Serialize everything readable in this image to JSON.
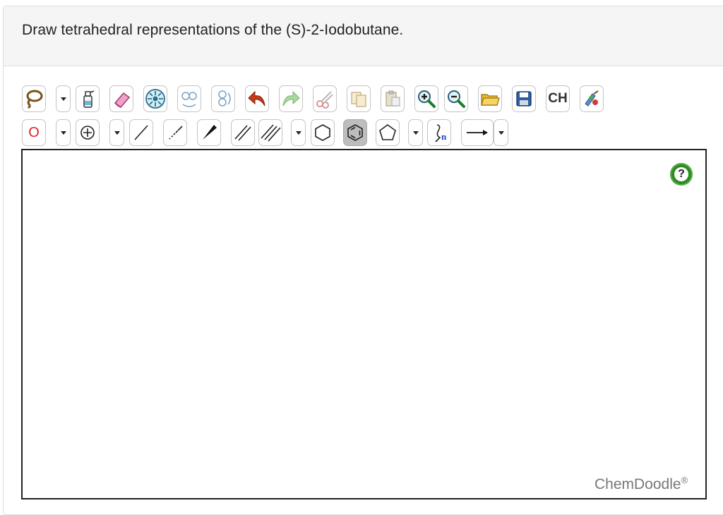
{
  "question": "Draw tetrahedral representations of the (S)-2-Iodobutane.",
  "toolbar_row1": [
    {
      "name": "lasso-tool-button",
      "icon": "lasso-icon"
    },
    {
      "name": "lasso-dropdown-button",
      "icon": "chevron-down-icon"
    },
    {
      "name": "clear-canvas-button",
      "icon": "spray-bottle-icon"
    },
    {
      "name": "eraser-button",
      "icon": "eraser-icon"
    },
    {
      "name": "center-molecule-button",
      "icon": "center-arrows-icon"
    },
    {
      "name": "flip-horizontal-button",
      "icon": "flip-horizontal-icon"
    },
    {
      "name": "flip-vertical-button",
      "icon": "flip-vertical-icon"
    },
    {
      "name": "undo-button",
      "icon": "undo-arrow-icon"
    },
    {
      "name": "redo-button",
      "icon": "redo-arrow-icon"
    },
    {
      "name": "cut-button",
      "icon": "scissors-icon"
    },
    {
      "name": "copy-button",
      "icon": "copy-icon"
    },
    {
      "name": "paste-button",
      "icon": "paste-icon"
    },
    {
      "name": "zoom-in-button",
      "icon": "zoom-in-icon"
    },
    {
      "name": "zoom-out-button",
      "icon": "zoom-out-icon"
    },
    {
      "name": "open-file-button",
      "icon": "folder-icon"
    },
    {
      "name": "save-button",
      "icon": "floppy-disk-icon"
    },
    {
      "name": "hydrogen-toggle-button",
      "icon": "ch-text-icon",
      "label": "CH"
    },
    {
      "name": "clean-structure-button",
      "icon": "clean-brush-icon"
    }
  ],
  "toolbar_row2": {
    "atom_label": "O",
    "ring_tools": [
      "cyclohexane-icon",
      "benzene-icon",
      "cyclopentane-icon"
    ],
    "chain_label": "n"
  },
  "canvas": {
    "help_symbol": "?",
    "brand": "ChemDoodle",
    "brand_mark": "®"
  },
  "colors": {
    "atom_red": "#e02020",
    "help_green": "#2f8a25",
    "selected_tool": "#bdbdbd"
  }
}
